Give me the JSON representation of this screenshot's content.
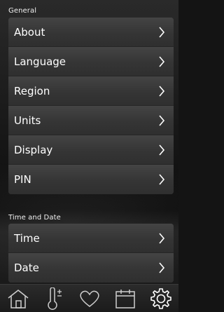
{
  "sections": {
    "general": {
      "title": "General",
      "items": [
        {
          "label": "About"
        },
        {
          "label": "Language"
        },
        {
          "label": "Region"
        },
        {
          "label": "Units"
        },
        {
          "label": "Display"
        },
        {
          "label": "PIN"
        }
      ]
    },
    "time_date": {
      "title": "Time and Date",
      "items": [
        {
          "label": "Time"
        },
        {
          "label": "Date"
        }
      ]
    }
  },
  "tabbar": {
    "tabs": [
      {
        "icon": "home-icon"
      },
      {
        "icon": "thermometer-icon"
      },
      {
        "icon": "heart-icon"
      },
      {
        "icon": "calendar-icon"
      },
      {
        "icon": "gear-icon",
        "active": true
      }
    ]
  }
}
